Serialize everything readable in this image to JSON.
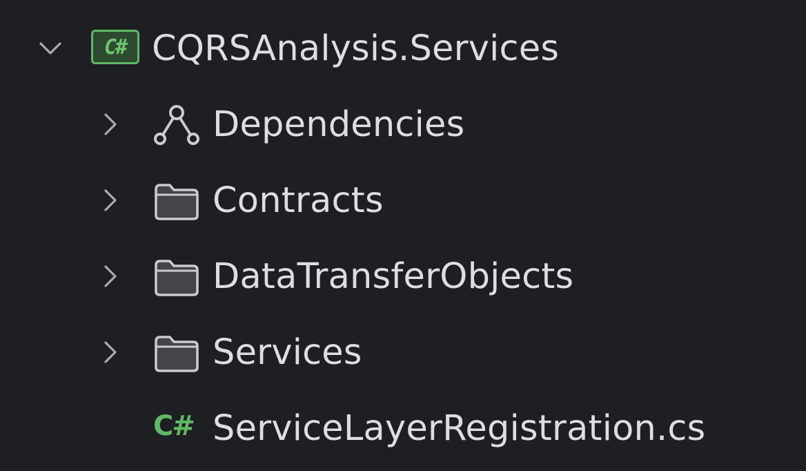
{
  "project": {
    "name": "CQRSAnalysis.Services",
    "icon": "csharp-project-icon",
    "badge_text": "C#",
    "expanded": true,
    "accent_color": "#5fb865"
  },
  "children": [
    {
      "label": "Dependencies",
      "icon": "dependencies-icon",
      "expandable": true
    },
    {
      "label": "Contracts",
      "icon": "folder-icon",
      "expandable": true
    },
    {
      "label": "DataTransferObjects",
      "icon": "folder-icon",
      "expandable": true
    },
    {
      "label": "Services",
      "icon": "folder-icon",
      "expandable": true
    },
    {
      "label": "ServiceLayerRegistration.cs",
      "icon": "csharp-file-icon",
      "icon_text": "C#",
      "expandable": false
    }
  ]
}
